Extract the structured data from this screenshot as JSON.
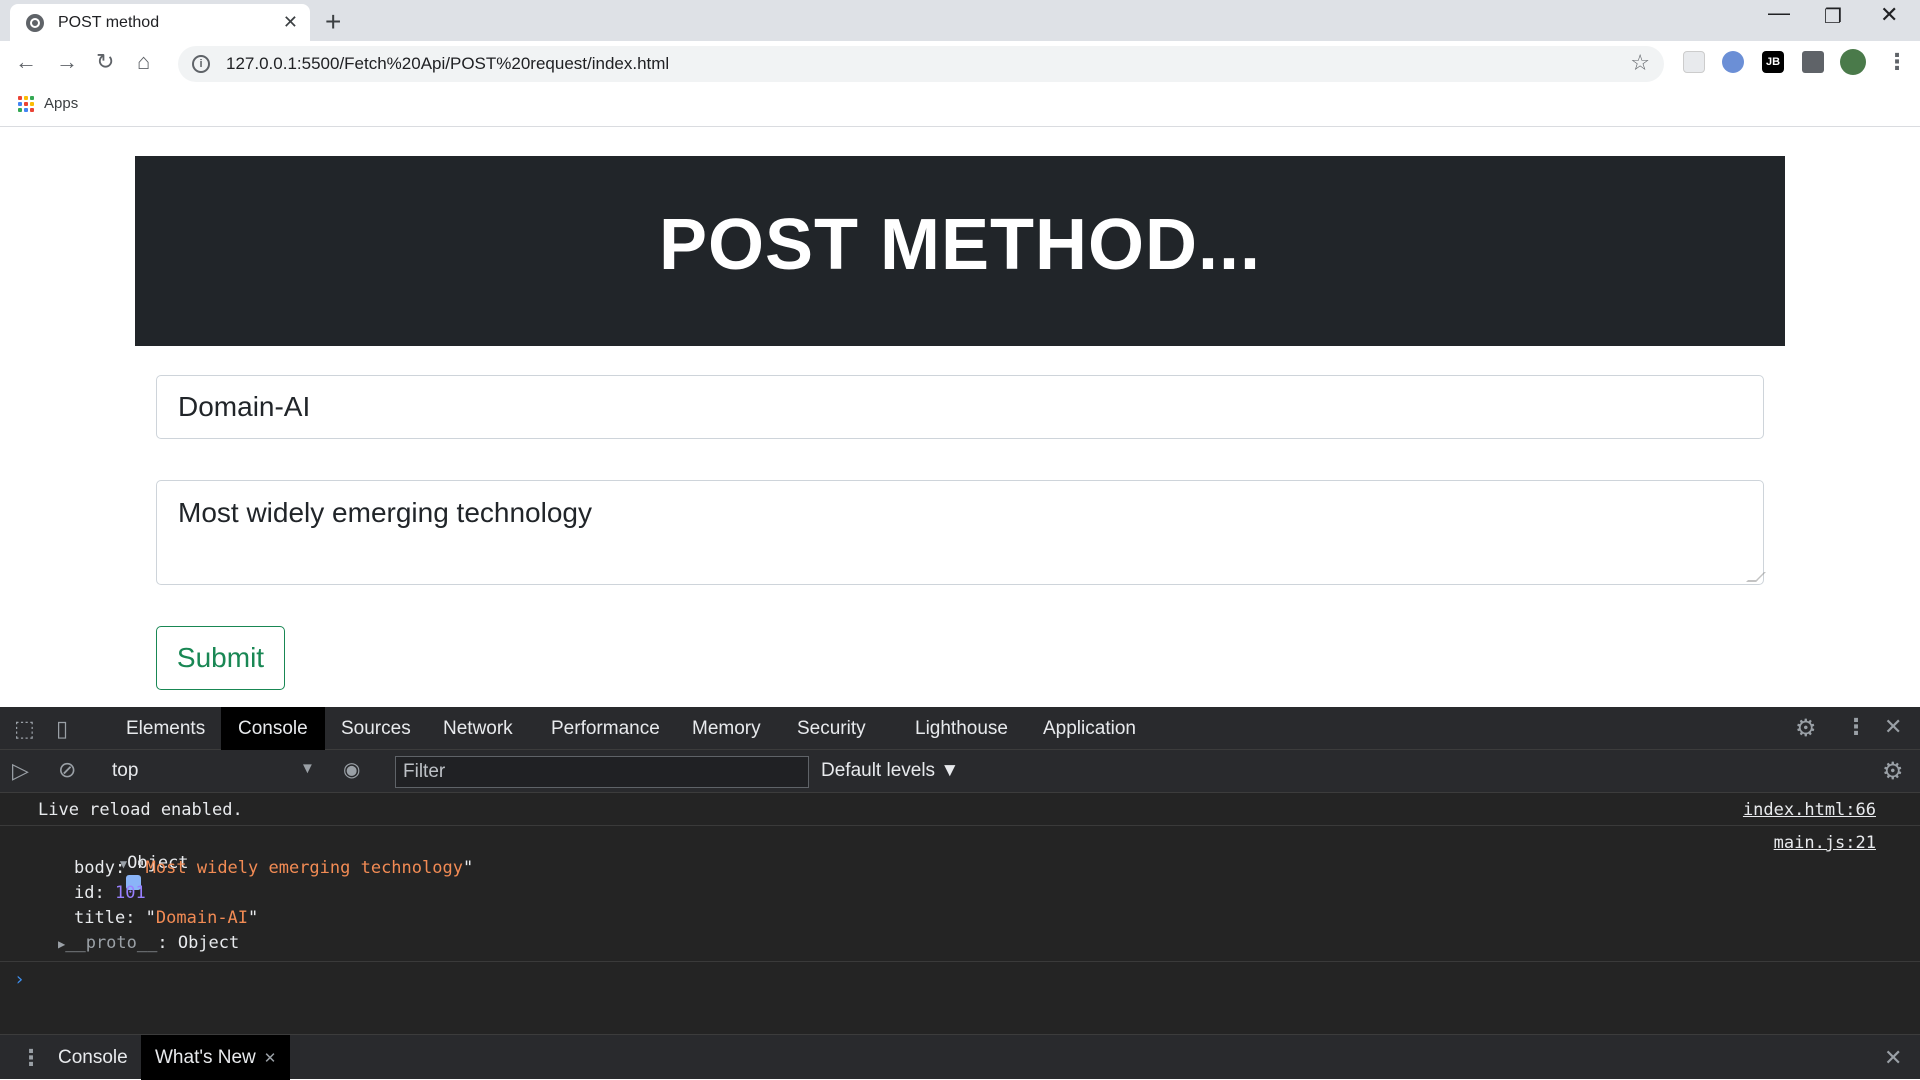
{
  "browser": {
    "tab_title": "POST method",
    "tab_close": "✕",
    "new_tab": "+",
    "url": "127.0.0.1:5500/Fetch%20Api/POST%20request/index.html",
    "bookmarks_apps": "Apps",
    "window_controls": {
      "minimize": "—",
      "restore": "❐",
      "close": "✕"
    },
    "nav": {
      "back": "←",
      "forward": "→",
      "reload": "↻",
      "home": "⌂",
      "star": "☆"
    }
  },
  "page": {
    "heading": "POST METHOD...",
    "title_value": "Domain-AI",
    "body_value": "Most widely emerging technology",
    "submit_label": "Submit"
  },
  "devtools": {
    "tabs": [
      "Elements",
      "Console",
      "Sources",
      "Network",
      "Performance",
      "Memory",
      "Security",
      "Lighthouse",
      "Application"
    ],
    "active_tab": "Console",
    "context": "top",
    "filter_placeholder": "Filter",
    "levels": "Default levels ▼",
    "console": {
      "msg1": "Live reload enabled.",
      "msg1_src": "index.html:66",
      "obj_label": "Object",
      "obj_src": "main.js:21",
      "body_key": "body",
      "body_val": "Most widely emerging technology",
      "id_key": "id",
      "id_val": "101",
      "title_key": "title",
      "title_val": "Domain-AI",
      "proto_key": "__proto__",
      "proto_val": "Object"
    },
    "drawer": {
      "tab1": "Console",
      "tab2": "What's New",
      "tab2_close": "✕"
    }
  },
  "colors": {
    "jumbotron": "#212529",
    "submit_accent": "#198754",
    "console_string": "#f28b54",
    "console_number": "#9980ff"
  }
}
